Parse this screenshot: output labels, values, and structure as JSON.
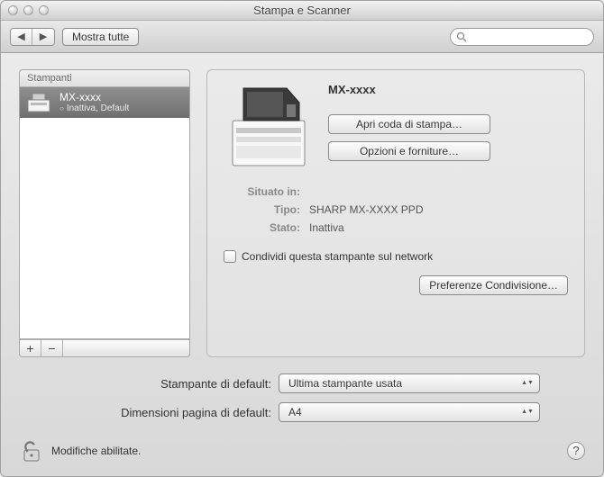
{
  "window": {
    "title": "Stampa e Scanner"
  },
  "toolbar": {
    "show_all_label": "Mostra tutte",
    "search_placeholder": ""
  },
  "sidebar": {
    "header": "Stampanti",
    "items": [
      {
        "name": "MX-xxxx",
        "status": "Inattiva, Default"
      }
    ]
  },
  "detail": {
    "printer_name": "MX-xxxx",
    "open_queue_label": "Apri coda di stampa…",
    "options_label": "Opzioni e forniture…",
    "located_label": "Situato in:",
    "located_value": "",
    "type_label": "Tipo:",
    "type_value": "SHARP MX-XXXX PPD",
    "state_label": "Stato:",
    "state_value": "Inattiva",
    "share_label": "Condividi questa stampante sul network",
    "sharing_prefs_label": "Preferenze Condivisione…"
  },
  "defaults": {
    "default_printer_label": "Stampante di default:",
    "default_printer_value": "Ultima stampante usata",
    "default_paper_label": "Dimensioni pagina di default:",
    "default_paper_value": "A4"
  },
  "footer": {
    "lock_text": "Modifiche abilitate."
  }
}
